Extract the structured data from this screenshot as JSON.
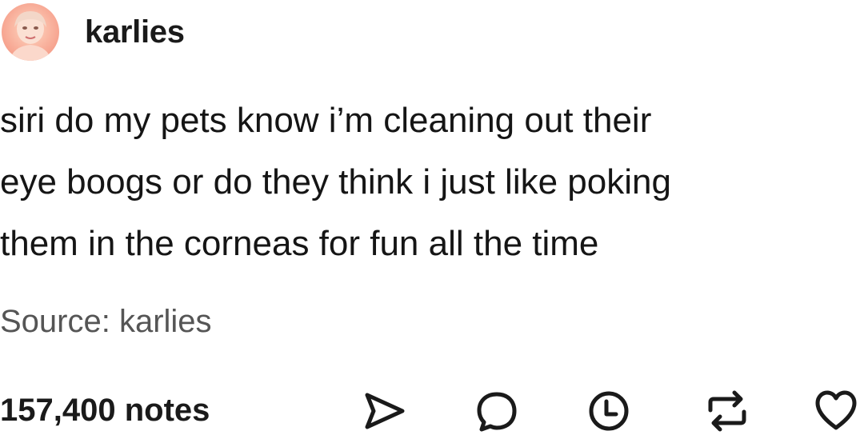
{
  "post": {
    "username": "karlies",
    "lines": [
      "siri do my pets know i’m cleaning out their",
      "eye boogs or do they think i just like poking",
      "them in the corneas for fun all the time"
    ],
    "source_label": "Source: karlies"
  },
  "footer": {
    "notes": "157,400 notes",
    "actions": [
      {
        "icon": "share-icon"
      },
      {
        "icon": "reply-icon"
      },
      {
        "icon": "history-icon"
      },
      {
        "icon": "reblog-icon"
      },
      {
        "icon": "heart-icon"
      }
    ]
  },
  "colors": {
    "text": "#151515",
    "source": "#555555",
    "icon_stroke": "#1a1a1a"
  }
}
